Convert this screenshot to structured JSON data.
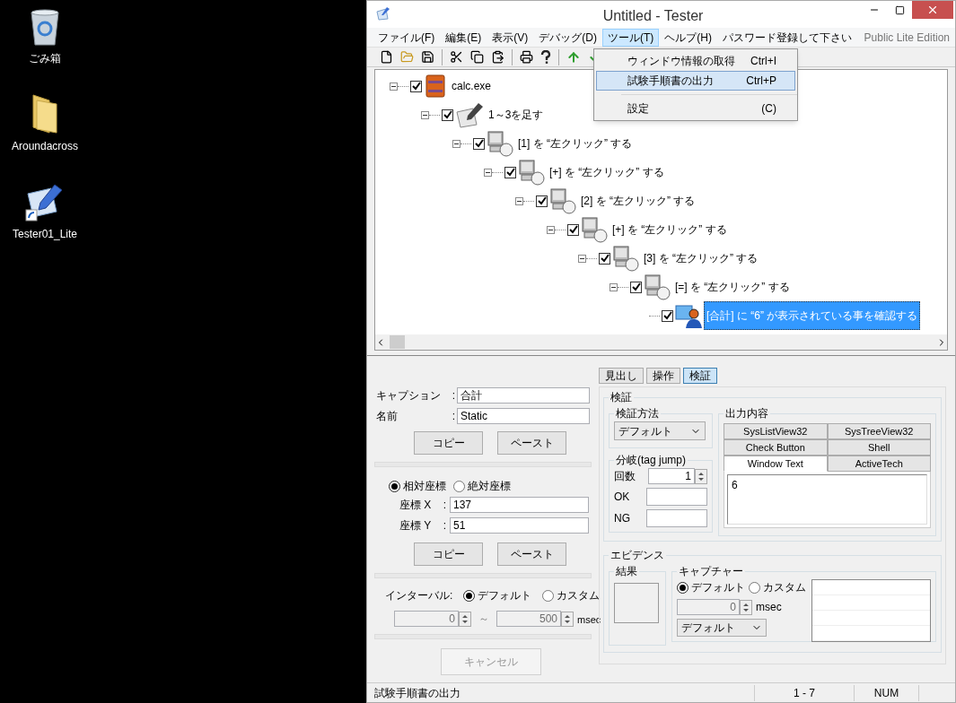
{
  "desktop": {
    "icons": [
      {
        "kind": "trash",
        "label": "ごみ箱"
      },
      {
        "kind": "folder",
        "label": "Aroundacross"
      },
      {
        "kind": "shortcut",
        "label": "Tester01_Lite"
      }
    ]
  },
  "window": {
    "title": "Untitled - Tester"
  },
  "menu_bar": {
    "items": [
      {
        "label": "ファイル(F)",
        "selected": false
      },
      {
        "label": "編集(E)",
        "selected": false
      },
      {
        "label": "表示(V)",
        "selected": false
      },
      {
        "label": "デバッグ(D)",
        "selected": false
      },
      {
        "label": "ツール(T)",
        "selected": true
      },
      {
        "label": "ヘルプ(H)",
        "selected": false
      },
      {
        "label": "パスワード登録して下さい",
        "selected": false
      }
    ],
    "edition": "Public Lite Edition"
  },
  "dropdown_menu": {
    "items": [
      {
        "kind": "item",
        "label": "ウィンドウ情報の取得",
        "shortcut": "Ctrl+I",
        "selected": false
      },
      {
        "kind": "item",
        "label": "試験手順書の出力",
        "shortcut": "Ctrl+P",
        "selected": true
      },
      {
        "kind": "separator"
      },
      {
        "kind": "item",
        "label": "設定",
        "shortcut": "(C)",
        "selected": false
      }
    ]
  },
  "tree": {
    "kind": "app",
    "label": "calc.exe",
    "checked": true,
    "selected": false,
    "expanded": true,
    "children": [
      {
        "kind": "note",
        "label": "1～3を足す",
        "checked": true,
        "selected": false,
        "expanded": true,
        "children": [
          {
            "kind": "click",
            "label": "[1] を “左クリック” する",
            "checked": true,
            "selected": false,
            "expanded": true,
            "children": [
              {
                "kind": "click",
                "label": "[+] を “左クリック” する",
                "checked": true,
                "selected": false,
                "expanded": true,
                "children": [
                  {
                    "kind": "click",
                    "label": "[2] を “左クリック” する",
                    "checked": true,
                    "selected": false,
                    "expanded": true,
                    "children": [
                      {
                        "kind": "click",
                        "label": "[+] を “左クリック” する",
                        "checked": true,
                        "selected": false,
                        "expanded": true,
                        "children": [
                          {
                            "kind": "click",
                            "label": "[3] を “左クリック” する",
                            "checked": true,
                            "selected": false,
                            "expanded": true,
                            "children": [
                              {
                                "kind": "click",
                                "label": "[=] を “左クリック” する",
                                "checked": true,
                                "selected": false,
                                "expanded": true,
                                "children": [
                                  {
                                    "kind": "verify",
                                    "label": "[合計] に “6” が表示されている事を確認する",
                                    "checked": true,
                                    "selected": true
                                  }
                                ]
                              }
                            ]
                          }
                        ]
                      }
                    ]
                  }
                ]
              }
            ]
          }
        ]
      }
    ]
  },
  "properties": {
    "fields": [
      {
        "label": "キャプション",
        "colon": ":",
        "value": "合計"
      },
      {
        "label": "名前",
        "colon": ":",
        "value": "Static"
      }
    ],
    "buttons_1": [
      "コピー",
      "ペースト"
    ],
    "coordinate_mode": [
      {
        "label": "相対座標",
        "selected": true
      },
      {
        "label": "絶対座標",
        "selected": false
      }
    ],
    "coordinates": [
      {
        "label": "座標 X",
        "colon": ":",
        "value": "137"
      },
      {
        "label": "座標 Y",
        "colon": ":",
        "value": "51"
      }
    ],
    "buttons_2": [
      "コピー",
      "ペースト"
    ],
    "interval": {
      "label": "インターバル:",
      "options": [
        {
          "label": "デフォルト",
          "selected": true
        },
        {
          "label": "カスタム",
          "selected": false
        }
      ],
      "min": "0",
      "tilde": "～",
      "max": "500",
      "unit": "msec",
      "disabled": true
    },
    "cancel": {
      "label": "キャンセル",
      "disabled": true
    }
  },
  "tabs": [
    {
      "label": "見出し",
      "selected": false
    },
    {
      "label": "操作",
      "selected": false
    },
    {
      "label": "検証",
      "selected": true
    }
  ],
  "verification": {
    "title": "検証",
    "method": {
      "title": "検証方法",
      "value": "デフォルト"
    },
    "branch": {
      "title": "分岐(tag jump)",
      "count_label": "回数",
      "count": "1",
      "ok_label": "OK",
      "ng_label": "NG"
    },
    "output": {
      "title": "出力内容",
      "tab_rows": [
        [
          {
            "label": "SysListView32",
            "selected": false
          },
          {
            "label": "SysTreeView32",
            "selected": false
          }
        ],
        [
          {
            "label": "Check Button",
            "selected": false
          },
          {
            "label": "Shell",
            "selected": false
          }
        ],
        [
          {
            "label": "Window Text",
            "selected": true
          },
          {
            "label": "ActiveTech",
            "selected": false
          }
        ]
      ],
      "text": "6"
    }
  },
  "evidence": {
    "title": "エビデンス",
    "result_title": "結果",
    "capture": {
      "title": "キャプチャー",
      "options": [
        {
          "label": "デフォルト",
          "selected": true
        },
        {
          "label": "カスタム",
          "selected": false
        }
      ],
      "delay": "0",
      "unit": "msec",
      "format": "デフォルト"
    }
  },
  "status_bar": [
    "試験手順書の出力",
    "1 - 7",
    "NUM"
  ]
}
